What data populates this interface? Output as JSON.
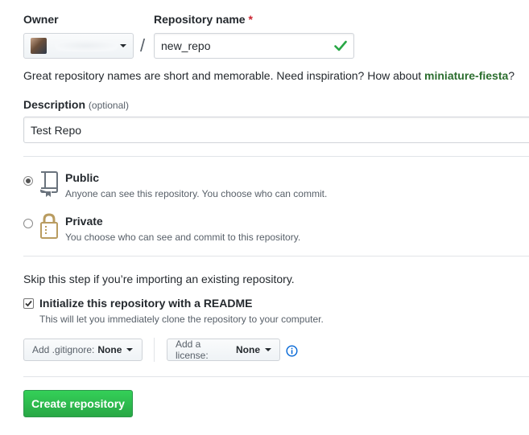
{
  "owner": {
    "label": "Owner"
  },
  "repo": {
    "label": "Repository name",
    "required_mark": "*",
    "value": "new_repo"
  },
  "separator": "/",
  "hint": {
    "text": "Great repository names are short and memorable. Need inspiration? How about ",
    "suggestion": "miniature-fiesta",
    "end": "?"
  },
  "description": {
    "label": "Description",
    "optional": "(optional)",
    "value": "Test Repo"
  },
  "visibility": {
    "public": {
      "title": "Public",
      "desc": "Anyone can see this repository. You choose who can commit.",
      "selected": true
    },
    "private": {
      "title": "Private",
      "desc": "You choose who can see and commit to this repository.",
      "selected": false
    }
  },
  "skip_text": "Skip this step if you’re importing an existing repository.",
  "readme": {
    "label": "Initialize this repository with a README",
    "desc": "This will let you immediately clone the repository to your computer.",
    "checked": true
  },
  "gitignore": {
    "prefix": "Add .gitignore:",
    "value": "None"
  },
  "license": {
    "prefix": "Add a license:",
    "value": "None"
  },
  "create_label": "Create repository",
  "colors": {
    "green": "#28a745",
    "link_green": "#2c6e2f",
    "check_green": "#28a745",
    "info_blue": "#0366d6"
  }
}
